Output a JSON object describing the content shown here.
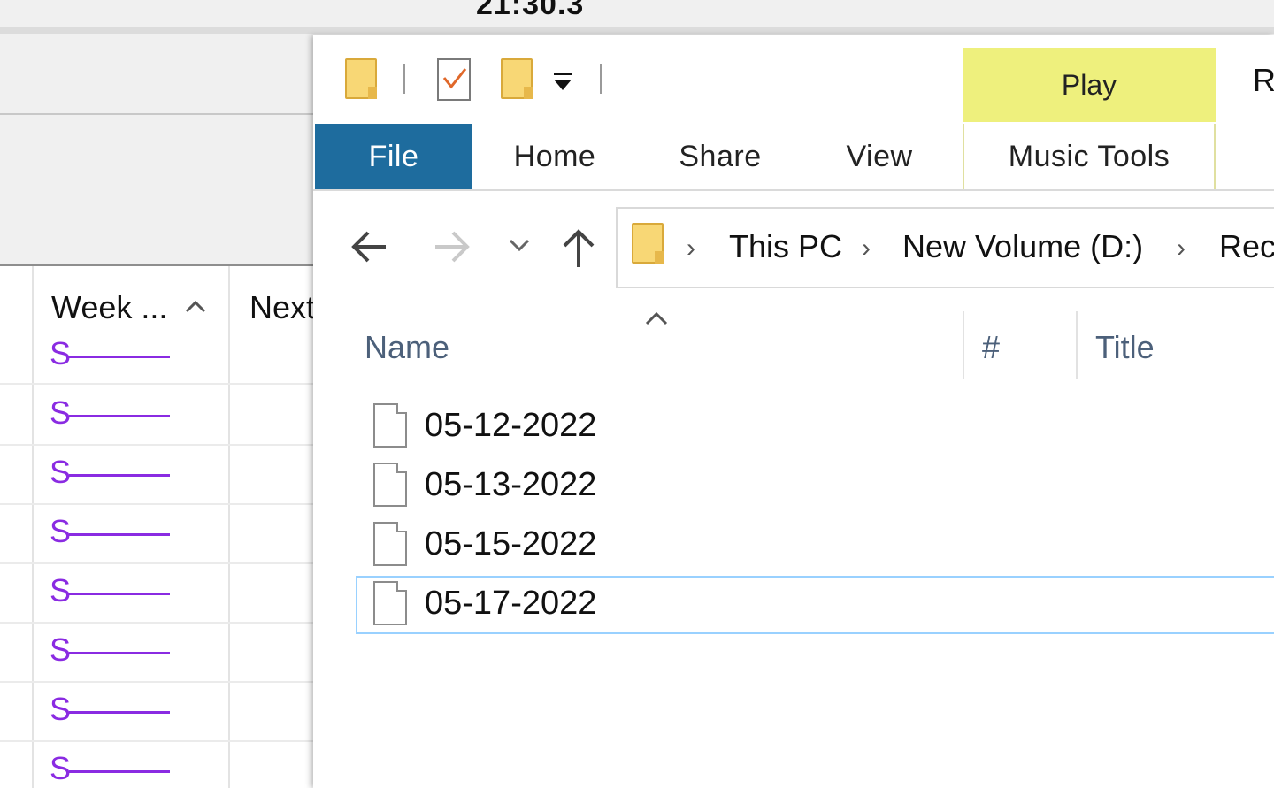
{
  "clock": "21:30.3",
  "background_app": {
    "columns": [
      "Week ...",
      "Next"
    ],
    "row_glyph": "S",
    "row_count": 8,
    "line_color": "#8a2be2"
  },
  "explorer": {
    "contextual_tab": "Play",
    "cut_tab_letter": "R",
    "ribbon_tabs": [
      "File",
      "Home",
      "Share",
      "View",
      "Music Tools"
    ],
    "file_tab_color": "#1e6c9e",
    "play_tab_color": "#eef07d",
    "breadcrumb": [
      "This PC",
      "New Volume (D:)",
      "Rec"
    ],
    "columns": [
      "Name",
      "#",
      "Title"
    ],
    "files": [
      "05-12-2022",
      "05-13-2022",
      "05-15-2022",
      "05-17-2022"
    ],
    "selected_file": "05-17-2022"
  },
  "icons": {
    "folder": "folder-icon",
    "properties": "properties-icon",
    "back": "back-arrow-icon",
    "forward": "forward-arrow-icon",
    "recent": "chevron-down-icon",
    "up": "up-arrow-icon",
    "file": "file-icon"
  }
}
